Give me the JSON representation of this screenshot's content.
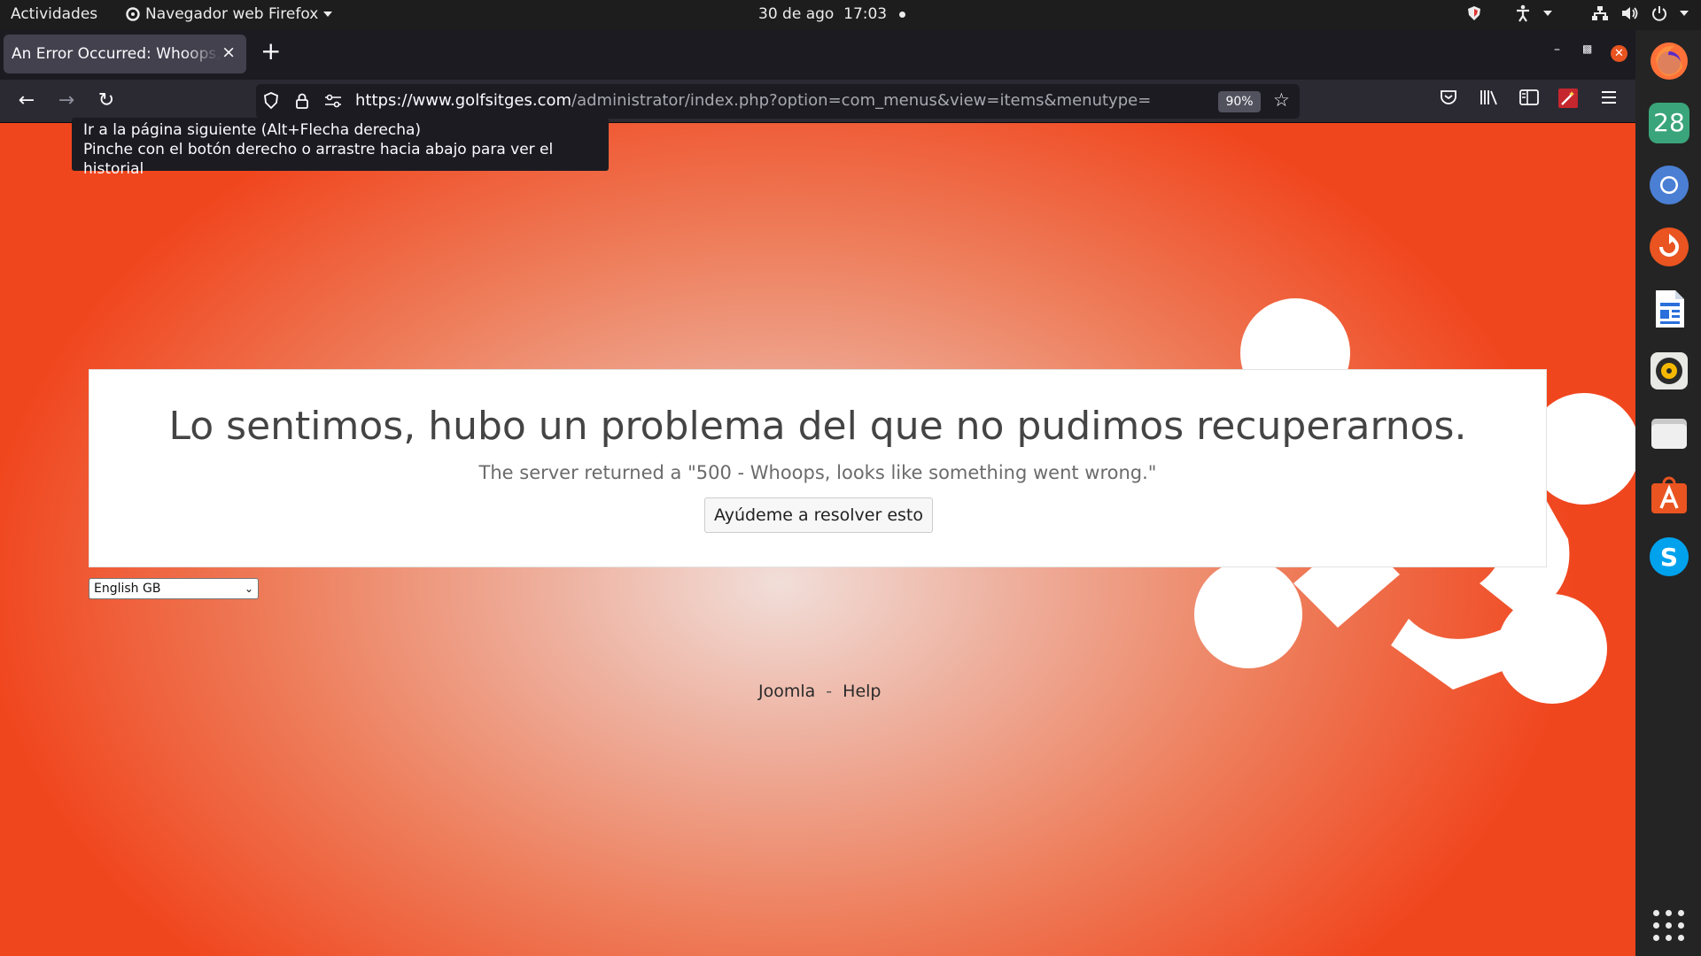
{
  "topbar": {
    "activities": "Actividades",
    "app_menu": "Navegador web Firefox",
    "date": "30 de ago",
    "time": "17:03"
  },
  "browser": {
    "tab_title": "An Error Occurred: Whoops, looks like something went wrong.",
    "tab_close": "×",
    "new_tab": "+",
    "url_host": "https://www.golfsitges.com",
    "url_path": "/administrator/index.php?option=com_menus&view=items&menutype=",
    "zoom": "90%"
  },
  "tooltip": {
    "line1": "Ir a la página siguiente (Alt+Flecha derecha)",
    "line2": "Pinche con el botón derecho o arrastre hacia abajo para ver el historial"
  },
  "page": {
    "heading": "Lo sentimos, hubo un problema del que no pudimos recuperarnos.",
    "message": "The server returned a \"500 - Whoops, looks like something went wrong.\"",
    "help_button": "Ayúdeme a resolver esto",
    "language_selected": "English GB",
    "footer_link_1": "Joomla",
    "footer_sep": "-",
    "footer_link_2": "Help"
  },
  "dock": {
    "calendar_day": "28",
    "items": [
      "firefox-icon",
      "calendar-icon",
      "chromium-icon",
      "update-icon",
      "writer-icon",
      "rhythmbox-icon",
      "files-icon",
      "software-icon",
      "skype-icon"
    ]
  },
  "colors": {
    "brand_orange": "#e95420",
    "page_red": "#f0461e"
  }
}
